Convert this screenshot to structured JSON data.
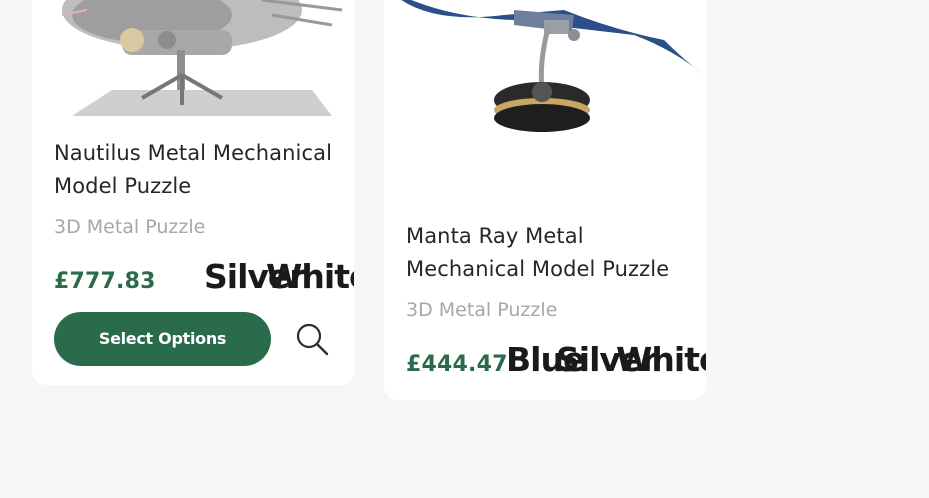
{
  "products": [
    {
      "name": "Nautilus Metal Mechanical Model Puzzle",
      "category": "3D Metal Puzzle",
      "price": "£777.83",
      "swatches": [
        "Silver",
        "White"
      ],
      "button_label": "Select Options",
      "image_icon": "nautilus-model-image"
    },
    {
      "name": "Manta Ray Metal Mechanical Model Puzzle",
      "category": "3D Metal Puzzle",
      "price": "£444.47",
      "swatches": [
        "Blue",
        "Silver",
        "White"
      ],
      "image_icon": "manta-ray-model-image"
    }
  ],
  "colors": {
    "accent_green": "#2a6b4c",
    "price_green": "#2c6a4c",
    "background": "#f5f6f8",
    "card": "#ffffff"
  }
}
